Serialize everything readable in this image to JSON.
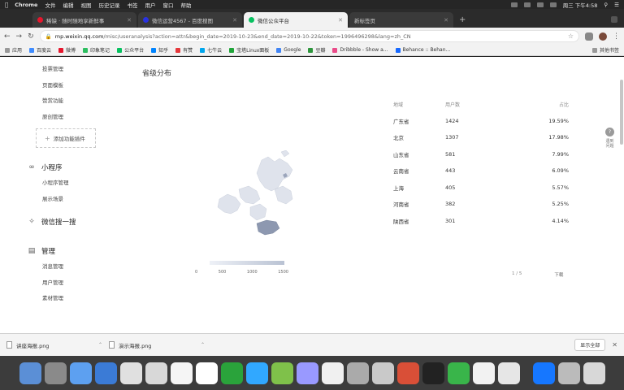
{
  "menubar": {
    "items": [
      "Chrome",
      "文件",
      "编辑",
      "视图",
      "历史记录",
      "书签",
      "用户",
      "窗口",
      "帮助"
    ],
    "clock": "周三 下午4:58"
  },
  "tabs": [
    {
      "label": "稀缺 · 随时随地享新鲜事"
    },
    {
      "label": "微信运营4567 - 百度搜图"
    },
    {
      "label": "微信公众平台"
    },
    {
      "label": "新标签页"
    }
  ],
  "address": {
    "host": "mp.weixin.qq.com",
    "path": "/misc/useranalysis?action=attr&begin_date=2019-10-23&end_date=2019-10-22&token=1996496298&lang=zh_CN"
  },
  "bookmarks": [
    "应用",
    "百度云",
    "微博",
    "印象笔记",
    "公众平台",
    "知乎",
    "有赞",
    "七牛云",
    "宝塔Linux面板",
    "Google",
    "豆瓣",
    "Dribbble - Show a...",
    "Behance :: Behan..."
  ],
  "bookmarks_other": "其他书签",
  "sidebar": {
    "top_items": [
      "投票管理",
      "页面模板",
      "赞赏功能",
      "原创管理"
    ],
    "add_plugin": "添加功能插件",
    "groups": [
      {
        "icon": "link-icon",
        "title": "小程序",
        "items": [
          "小程序管理",
          "展示场景"
        ]
      },
      {
        "icon": "sparkle-icon",
        "title": "微信搜一搜",
        "items": []
      },
      {
        "icon": "inbox-icon",
        "title": "管理",
        "items": [
          "消息管理",
          "用户管理",
          "素材管理"
        ]
      }
    ]
  },
  "section_title": "省级分布",
  "map_legend": {
    "ticks": [
      "0",
      "500",
      "1000",
      "1500"
    ],
    "colors": [
      "#eef1f7",
      "#b9c2d3"
    ]
  },
  "table": {
    "headers": [
      "地域",
      "用户数",
      "占比"
    ],
    "rows": [
      [
        "广东省",
        "1424",
        "19.59%"
      ],
      [
        "北京",
        "1307",
        "17.98%"
      ],
      [
        "山东省",
        "581",
        "7.99%"
      ],
      [
        "云南省",
        "443",
        "6.09%"
      ],
      [
        "上海",
        "405",
        "5.57%"
      ],
      [
        "河南省",
        "382",
        "5.25%"
      ],
      [
        "陕西省",
        "301",
        "4.14%"
      ]
    ]
  },
  "pager": {
    "page": "1 / 5",
    "export": "下载"
  },
  "help": {
    "label": "遇到问题"
  },
  "downloads": {
    "files": [
      "讲座海报.png",
      "演示海报.png"
    ],
    "show_all": "显示全部"
  },
  "dock_colors": [
    "#5b8fd6",
    "#8a8a8a",
    "#5da0f0",
    "#3b7bd6",
    "#e0e0e0",
    "#d8d8d8",
    "#f5f5f5",
    "#ffffff",
    "#2aa33b",
    "#31a8ff",
    "#7fc14a",
    "#9999ff",
    "#f0f0f0",
    "#aaaaaa",
    "#c9c9c9",
    "#d94f37",
    "#222222",
    "#39b54a",
    "#f2f2f2",
    "#e6e6e6",
    "#1677ff",
    "#bbbbbb",
    "#d8d8d8"
  ]
}
